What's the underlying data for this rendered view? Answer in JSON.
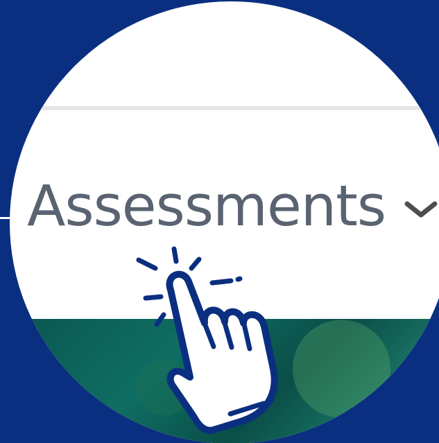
{
  "menu": {
    "label": "Assessments",
    "expand_icon": "chevron-down-icon",
    "pointer_icon": "click-hand-icon"
  },
  "colors": {
    "background": "#0b2f80",
    "circle": "#ffffff",
    "text": "#5a6371",
    "accent": "#0b2f80"
  }
}
